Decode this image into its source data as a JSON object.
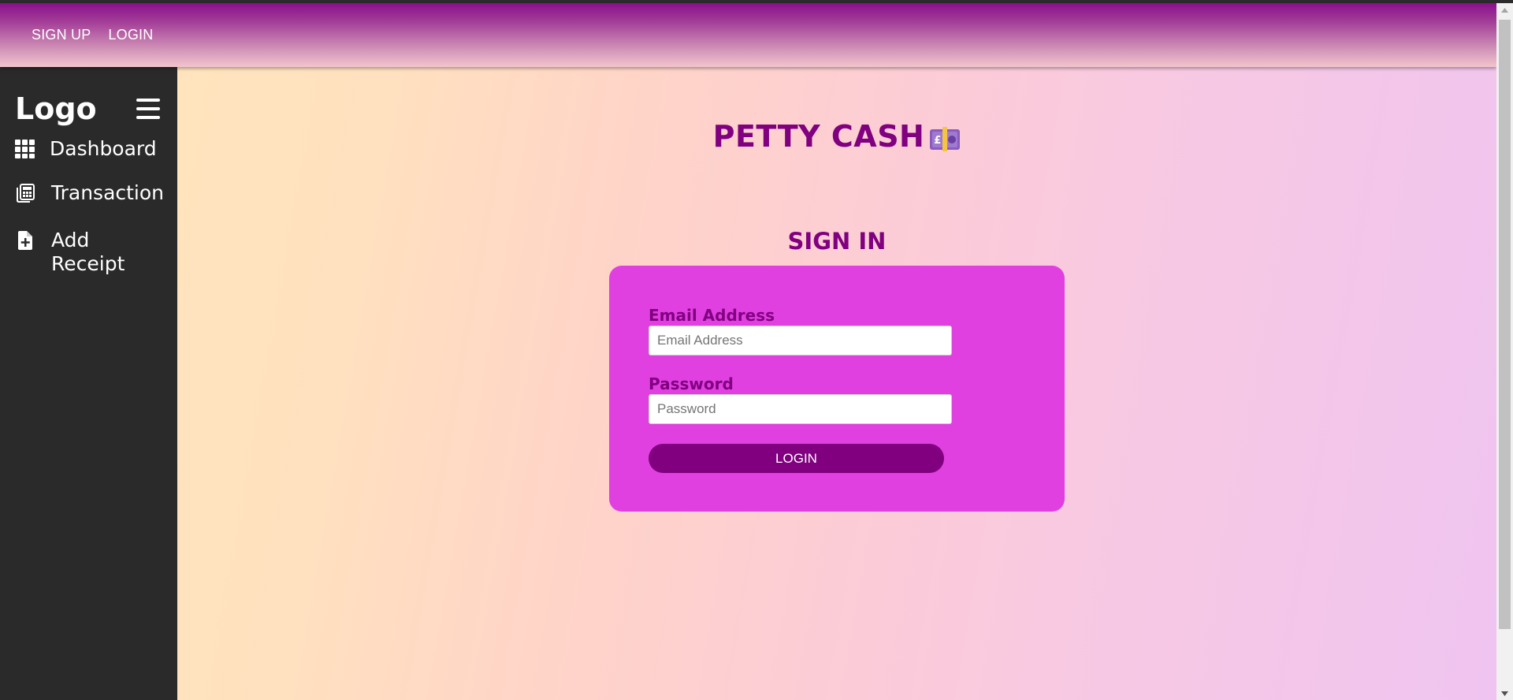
{
  "topnav": {
    "signup_label": "SIGN UP",
    "login_label": "LOGIN"
  },
  "sidebar": {
    "logo": "Logo",
    "items": [
      {
        "label": "Dashboard",
        "icon": "grid-icon"
      },
      {
        "label": "Transaction",
        "icon": "calculator-icon"
      },
      {
        "label": "Add Receipt",
        "icon": "file-plus-icon"
      }
    ]
  },
  "main": {
    "title": "PETTY CASH",
    "title_icon": "pound-banknote-icon",
    "signin_heading": "SIGN IN",
    "form": {
      "email_label": "Email Address",
      "email_placeholder": "Email Address",
      "email_value": "",
      "password_label": "Password",
      "password_placeholder": "Password",
      "password_value": "",
      "login_button": "LOGIN"
    }
  },
  "colors": {
    "brand_purple": "#800080",
    "card_magenta": "#e140e0",
    "sidebar_bg": "#2a2a2a"
  }
}
